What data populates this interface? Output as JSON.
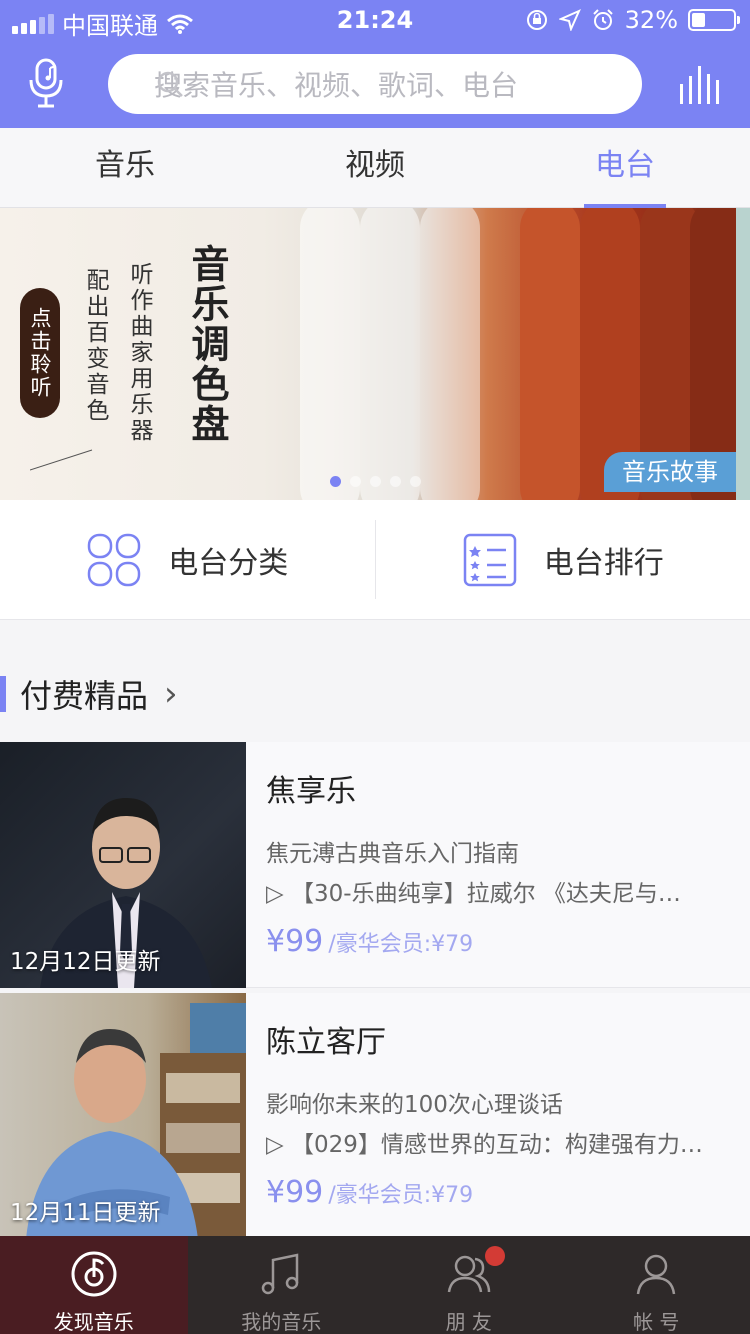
{
  "status_bar": {
    "carrier": "中国联通",
    "time": "21:24",
    "battery": "32%"
  },
  "search": {
    "placeholder": "搜索音乐、视频、歌词、电台"
  },
  "tabs": [
    {
      "label": "音乐"
    },
    {
      "label": "视频"
    },
    {
      "label": "电台",
      "active": true
    }
  ],
  "banner": {
    "headline": "音乐调色盘",
    "line1": "听作曲家用乐器",
    "line2": "配出百变音色",
    "pill": "点击聆听",
    "tag": "音乐故事",
    "dots": 5,
    "active_dot": 0
  },
  "shortcuts": [
    {
      "label": "电台分类",
      "icon": "category-grid-icon"
    },
    {
      "label": "电台排行",
      "icon": "ranking-list-icon"
    }
  ],
  "section": {
    "title": "付费精品"
  },
  "items": [
    {
      "title": "焦享乐",
      "desc": "焦元溥古典音乐入门指南",
      "episode": "【30-乐曲纯享】拉威尔 《达夫尼与…",
      "price": "¥99",
      "member": "/豪华会员:¥79",
      "update": "12月12日更新"
    },
    {
      "title": "陈立客厅",
      "desc": "影响你未来的100次心理谈话",
      "episode": "【029】情感世界的互动：构建强有力…",
      "price": "¥99",
      "member": "/豪华会员:¥79",
      "update": "12月11日更新"
    }
  ],
  "bottom_nav": [
    {
      "label": "发现音乐",
      "active": true
    },
    {
      "label": "我的音乐"
    },
    {
      "label": "朋 友",
      "badge": true
    },
    {
      "label": "帐 号"
    }
  ],
  "colors": {
    "accent": "#7b83f3",
    "nav_bg": "#2e2929",
    "nav_active": "#4a1d22"
  }
}
